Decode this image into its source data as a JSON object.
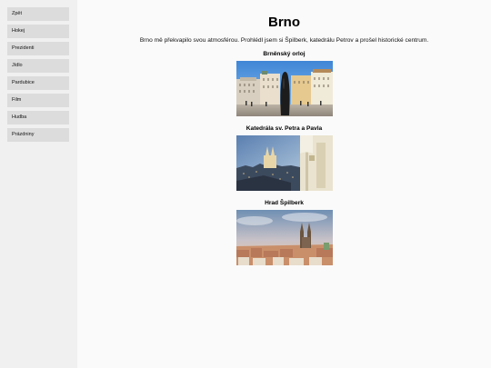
{
  "sidebar": {
    "items": [
      {
        "label": "Zpět"
      },
      {
        "label": "Hokej"
      },
      {
        "label": "Prezidenti"
      },
      {
        "label": "Jídlo"
      },
      {
        "label": "Pardubice"
      },
      {
        "label": "Film"
      },
      {
        "label": "Hudba"
      },
      {
        "label": "Prázdniny"
      }
    ]
  },
  "main": {
    "title": "Brno",
    "intro": "Brno mě překvapilo svou atmosférou. Prohlédl jsem si Špilberk, katedrálu Petrov a prošel historické centrum.",
    "sections": [
      {
        "title": "Brněnský orloj"
      },
      {
        "title": "Katedrála sv. Petra a Pavla"
      },
      {
        "title": "Hrad Špilberk"
      }
    ]
  }
}
